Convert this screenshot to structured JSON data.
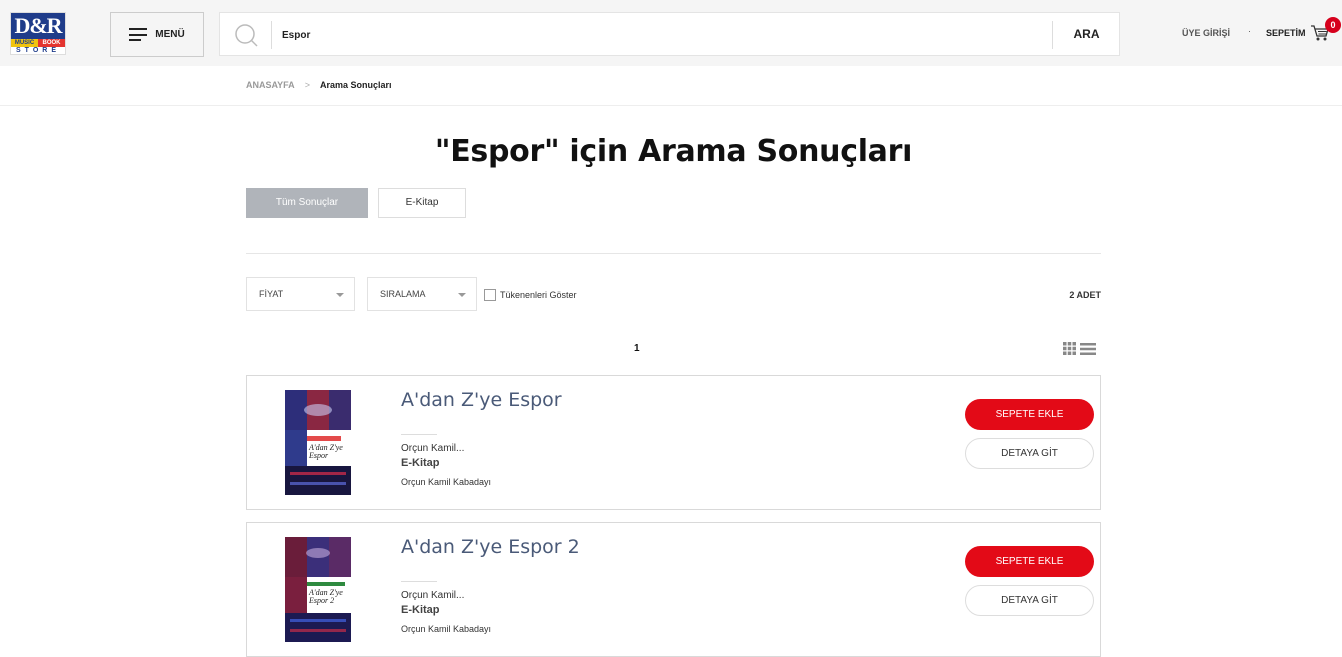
{
  "header": {
    "logo_text": "D&R",
    "logo_music": "MUSIC",
    "logo_book": "BOOK",
    "logo_store": "STORE",
    "menu_label": "MENÜ",
    "search_value": "Espor",
    "search_button": "ARA",
    "login_label": "ÜYE GİRİŞİ",
    "separator": "·",
    "cart_label": "SEPETİM",
    "cart_count": "0"
  },
  "breadcrumb": {
    "home": "ANASAYFA",
    "separator": ">",
    "current": "Arama Sonuçları"
  },
  "page_title": "\"Espor\" için Arama Sonuçları",
  "tabs": [
    {
      "label": "Tüm Sonuçlar",
      "active": true
    },
    {
      "label": "E-Kitap",
      "active": false
    }
  ],
  "filters": {
    "price": "FİYAT",
    "sort": "SIRALAMA",
    "show_out_of_stock": "Tükenenleri Göster",
    "count": "2 ADET"
  },
  "pagination": {
    "current": "1"
  },
  "products": [
    {
      "title": "A'dan Z'ye Espor",
      "author_short": "Orçun Kamil...",
      "type": "E-Kitap",
      "author_full": "Orçun Kamil Kabadayı",
      "add_button": "SEPETE EKLE",
      "detail_button": "DETAYA GİT"
    },
    {
      "title": "A'dan Z'ye Espor 2",
      "author_short": "Orçun Kamil...",
      "type": "E-Kitap",
      "author_full": "Orçun Kamil Kabadayı",
      "add_button": "SEPETE EKLE",
      "detail_button": "DETAYA GİT"
    }
  ],
  "colors": {
    "accent_red": "#e30a17",
    "badge_red": "#d6001c",
    "logo_blue": "#1f3c8a",
    "tab_active": "#b0b4ba",
    "product_title": "#4a5a78"
  }
}
